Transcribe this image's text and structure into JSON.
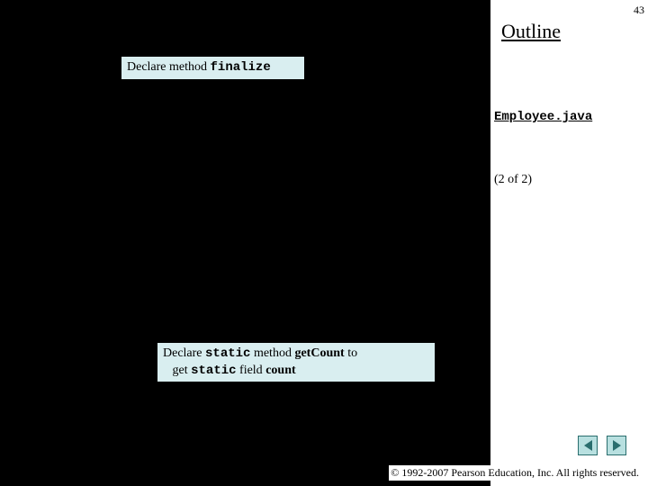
{
  "page_number": "43",
  "outline": {
    "title": "Outline"
  },
  "filename": "Employee.java",
  "page_of": "(2 of  2)",
  "callout1": {
    "prefix": "Declare method ",
    "method": "finalize"
  },
  "callout2": {
    "l1_prefix": "Declare ",
    "l1_kw": "static",
    "l1_mid": " method ",
    "l1_method": "getCount",
    "l1_suffix": " to",
    "l2_prefix": "get ",
    "l2_kw": "static",
    "l2_mid": " field ",
    "l2_field": "count"
  },
  "nav": {
    "prev": "prev",
    "next": "next"
  },
  "copyright": "© 1992-2007 Pearson Education, Inc.  All rights reserved."
}
